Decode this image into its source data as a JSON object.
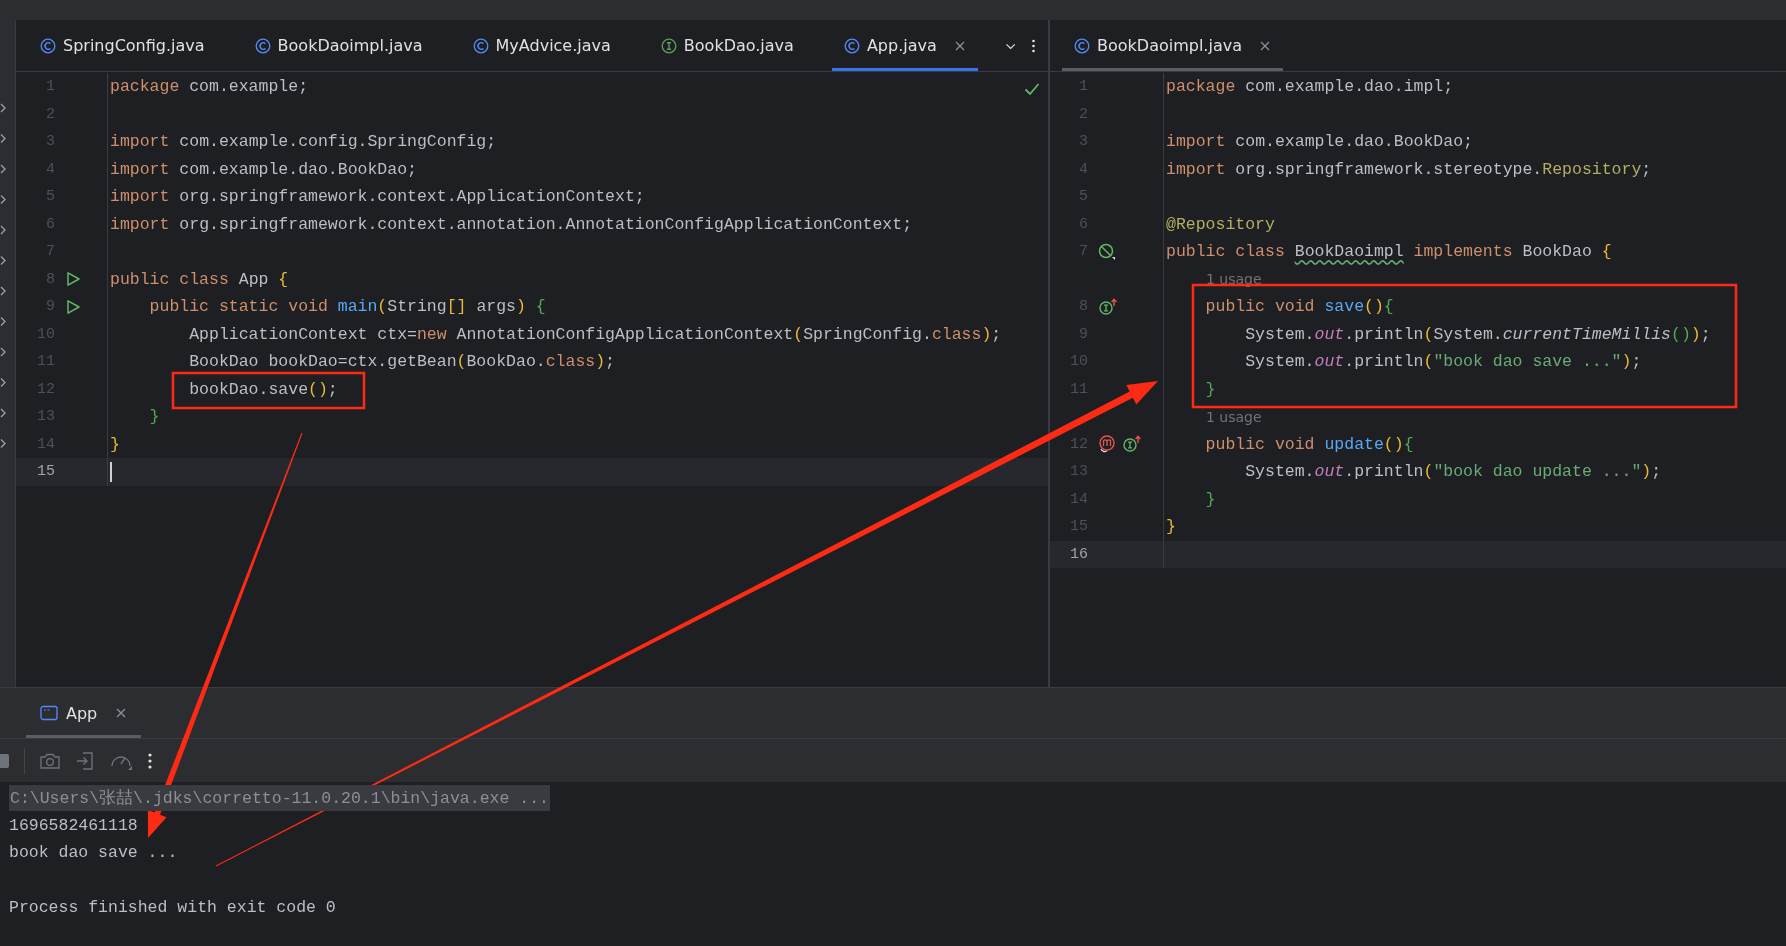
{
  "editors": [
    {
      "focused": true,
      "tab_menu": true,
      "inspection_ok": true,
      "tabs": [
        {
          "label": "SpringConfig.java",
          "kind": "class",
          "selected": false
        },
        {
          "label": "BookDaoimpl.java",
          "kind": "class",
          "selected": false
        },
        {
          "label": "MyAdvice.java",
          "kind": "class",
          "selected": false
        },
        {
          "label": "BookDao.java",
          "kind": "interface",
          "selected": false
        },
        {
          "label": "App.java",
          "kind": "class",
          "selected": true
        }
      ],
      "lines": [
        {
          "number": "1",
          "tokens": [
            {
              "text": "package",
              "kind": "kw"
            },
            {
              "text": " com.example;",
              "kind": "txt"
            }
          ]
        },
        {
          "number": "2"
        },
        {
          "number": "3",
          "tokens": [
            {
              "text": "import",
              "kind": "kw"
            },
            {
              "text": " com.example.config.SpringConfig;",
              "kind": "txt"
            }
          ]
        },
        {
          "number": "4",
          "tokens": [
            {
              "text": "import",
              "kind": "kw"
            },
            {
              "text": " com.example.dao.BookDao;",
              "kind": "txt"
            }
          ]
        },
        {
          "number": "5",
          "tokens": [
            {
              "text": "import",
              "kind": "kw"
            },
            {
              "text": " org.springframework.context.ApplicationContext;",
              "kind": "txt"
            }
          ]
        },
        {
          "number": "6",
          "tokens": [
            {
              "text": "import",
              "kind": "kw"
            },
            {
              "text": " org.springframework.context.annotation.AnnotationConfigApplicationContext;",
              "kind": "txt"
            }
          ]
        },
        {
          "number": "7"
        },
        {
          "number": "8",
          "gutter_icons": [
            {
              "kind": "run"
            }
          ],
          "tokens": [
            {
              "text": "public class",
              "kind": "kw"
            },
            {
              "text": " App ",
              "kind": "txt"
            },
            {
              "text": "{",
              "kind": "p1"
            }
          ]
        },
        {
          "number": "9",
          "gutter_icons": [
            {
              "kind": "run"
            }
          ],
          "tokens": [
            {
              "text": "    public static void ",
              "kind": "kw"
            },
            {
              "text": "main",
              "kind": "fn"
            },
            {
              "text": "(",
              "kind": "p1"
            },
            {
              "text": "String",
              "kind": "txt"
            },
            {
              "text": "[]",
              "kind": "p1"
            },
            {
              "text": " args",
              "kind": "txt"
            },
            {
              "text": ")",
              "kind": "p1"
            },
            {
              "text": " {",
              "kind": "p2"
            }
          ]
        },
        {
          "number": "10",
          "tokens": [
            {
              "text": "        ApplicationContext ctx=",
              "kind": "txt"
            },
            {
              "text": "new",
              "kind": "kw"
            },
            {
              "text": " AnnotationConfigApplicationContext",
              "kind": "txt"
            },
            {
              "text": "(",
              "kind": "p1"
            },
            {
              "text": "SpringConfig.",
              "kind": "txt"
            },
            {
              "text": "class",
              "kind": "kw"
            },
            {
              "text": ")",
              "kind": "p1"
            },
            {
              "text": ";",
              "kind": "txt"
            }
          ]
        },
        {
          "number": "11",
          "tokens": [
            {
              "text": "        BookDao bookDao=ctx.getBean",
              "kind": "txt"
            },
            {
              "text": "(",
              "kind": "p1"
            },
            {
              "text": "BookDao.",
              "kind": "txt"
            },
            {
              "text": "class",
              "kind": "kw"
            },
            {
              "text": ")",
              "kind": "p1"
            },
            {
              "text": ";",
              "kind": "txt"
            }
          ]
        },
        {
          "number": "12",
          "tokens": [
            {
              "text": "        bookDao.save",
              "kind": "txt"
            },
            {
              "text": "()",
              "kind": "p1"
            },
            {
              "text": ";",
              "kind": "txt"
            }
          ]
        },
        {
          "number": "13",
          "tokens": [
            {
              "text": "    }",
              "kind": "p2"
            }
          ]
        },
        {
          "number": "14",
          "tokens": [
            {
              "text": "}",
              "kind": "p1"
            }
          ]
        },
        {
          "number": "15",
          "current": true,
          "cursor": true
        }
      ]
    },
    {
      "focused": false,
      "tab_menu": false,
      "inspection_ok": false,
      "tabs": [
        {
          "label": "BookDaoimpl.java",
          "kind": "class",
          "selected": true
        }
      ],
      "lines": [
        {
          "number": "1",
          "tokens": [
            {
              "text": "package",
              "kind": "kw"
            },
            {
              "text": " com.example.dao.impl;",
              "kind": "txt"
            }
          ]
        },
        {
          "number": "2"
        },
        {
          "number": "3",
          "tokens": [
            {
              "text": "import",
              "kind": "kw"
            },
            {
              "text": " com.example.dao.BookDao;",
              "kind": "txt"
            }
          ]
        },
        {
          "number": "4",
          "tokens": [
            {
              "text": "import",
              "kind": "kw"
            },
            {
              "text": " org.springframework.stereotype.",
              "kind": "txt"
            },
            {
              "text": "Repository",
              "kind": "ann"
            },
            {
              "text": ";",
              "kind": "txt"
            }
          ]
        },
        {
          "number": "5"
        },
        {
          "number": "6",
          "tokens": [
            {
              "text": "@Repository",
              "kind": "ann"
            }
          ]
        },
        {
          "number": "7",
          "gutter_icons": [
            {
              "kind": "bean"
            }
          ],
          "tokens": [
            {
              "text": "public class ",
              "kind": "kw"
            },
            {
              "text": "BookDaoimpl",
              "kind": "typo"
            },
            {
              "text": " implements",
              "kind": "kw"
            },
            {
              "text": " BookDao ",
              "kind": "txt"
            },
            {
              "text": "{",
              "kind": "p1"
            }
          ]
        },
        {
          "kind": "hint",
          "text": "1 usage"
        },
        {
          "number": "8",
          "gutter_icons": [
            {
              "kind": "implements"
            }
          ],
          "tokens": [
            {
              "text": "    public void ",
              "kind": "kw"
            },
            {
              "text": "save",
              "kind": "fn"
            },
            {
              "text": "()",
              "kind": "p1"
            },
            {
              "text": "{",
              "kind": "p2"
            }
          ]
        },
        {
          "number": "9",
          "tokens": [
            {
              "text": "        System.",
              "kind": "txt"
            },
            {
              "text": "out",
              "kind": "field"
            },
            {
              "text": ".println",
              "kind": "txt"
            },
            {
              "text": "(",
              "kind": "p1"
            },
            {
              "text": "System.",
              "kind": "txt"
            },
            {
              "text": "currentTimeMillis",
              "kind": "static"
            },
            {
              "text": "()",
              "kind": "p2"
            },
            {
              "text": ")",
              "kind": "p1"
            },
            {
              "text": ";",
              "kind": "txt"
            }
          ]
        },
        {
          "number": "10",
          "tokens": [
            {
              "text": "        System.",
              "kind": "txt"
            },
            {
              "text": "out",
              "kind": "field"
            },
            {
              "text": ".println",
              "kind": "txt"
            },
            {
              "text": "(",
              "kind": "p1"
            },
            {
              "text": "\"book dao save ...\"",
              "kind": "str"
            },
            {
              "text": ")",
              "kind": "p1"
            },
            {
              "text": ";",
              "kind": "txt"
            }
          ]
        },
        {
          "number": "11",
          "tokens": [
            {
              "text": "    }",
              "kind": "p2"
            }
          ]
        },
        {
          "kind": "hint",
          "text": "1 usage"
        },
        {
          "number": "12",
          "gutter_icons": [
            {
              "kind": "override"
            },
            {
              "kind": "implements"
            }
          ],
          "tokens": [
            {
              "text": "    public void ",
              "kind": "kw"
            },
            {
              "text": "update",
              "kind": "fn"
            },
            {
              "text": "()",
              "kind": "p1"
            },
            {
              "text": "{",
              "kind": "p2"
            }
          ]
        },
        {
          "number": "13",
          "tokens": [
            {
              "text": "        System.",
              "kind": "txt"
            },
            {
              "text": "out",
              "kind": "field"
            },
            {
              "text": ".println",
              "kind": "txt"
            },
            {
              "text": "(",
              "kind": "p1"
            },
            {
              "text": "\"book dao update ...\"",
              "kind": "str"
            },
            {
              "text": ")",
              "kind": "p1"
            },
            {
              "text": ";",
              "kind": "txt"
            }
          ]
        },
        {
          "number": "14",
          "tokens": [
            {
              "text": "    }",
              "kind": "p2"
            }
          ]
        },
        {
          "number": "15",
          "tokens": [
            {
              "text": "}",
              "kind": "p1"
            }
          ]
        },
        {
          "number": "16",
          "current": true
        }
      ]
    }
  ],
  "run_panel": {
    "tabs": [
      {
        "label": "App",
        "selected": true
      }
    ],
    "console": [
      {
        "kind": "command",
        "text": "C:\\Users\\张喆\\.jdks\\corretto-11.0.20.1\\bin\\java.exe ..."
      },
      {
        "kind": "output",
        "text": "1696582461118"
      },
      {
        "kind": "output",
        "text": "book dao save ..."
      },
      {
        "kind": "blank"
      },
      {
        "kind": "output",
        "text": "Process finished with exit code 0"
      }
    ]
  }
}
